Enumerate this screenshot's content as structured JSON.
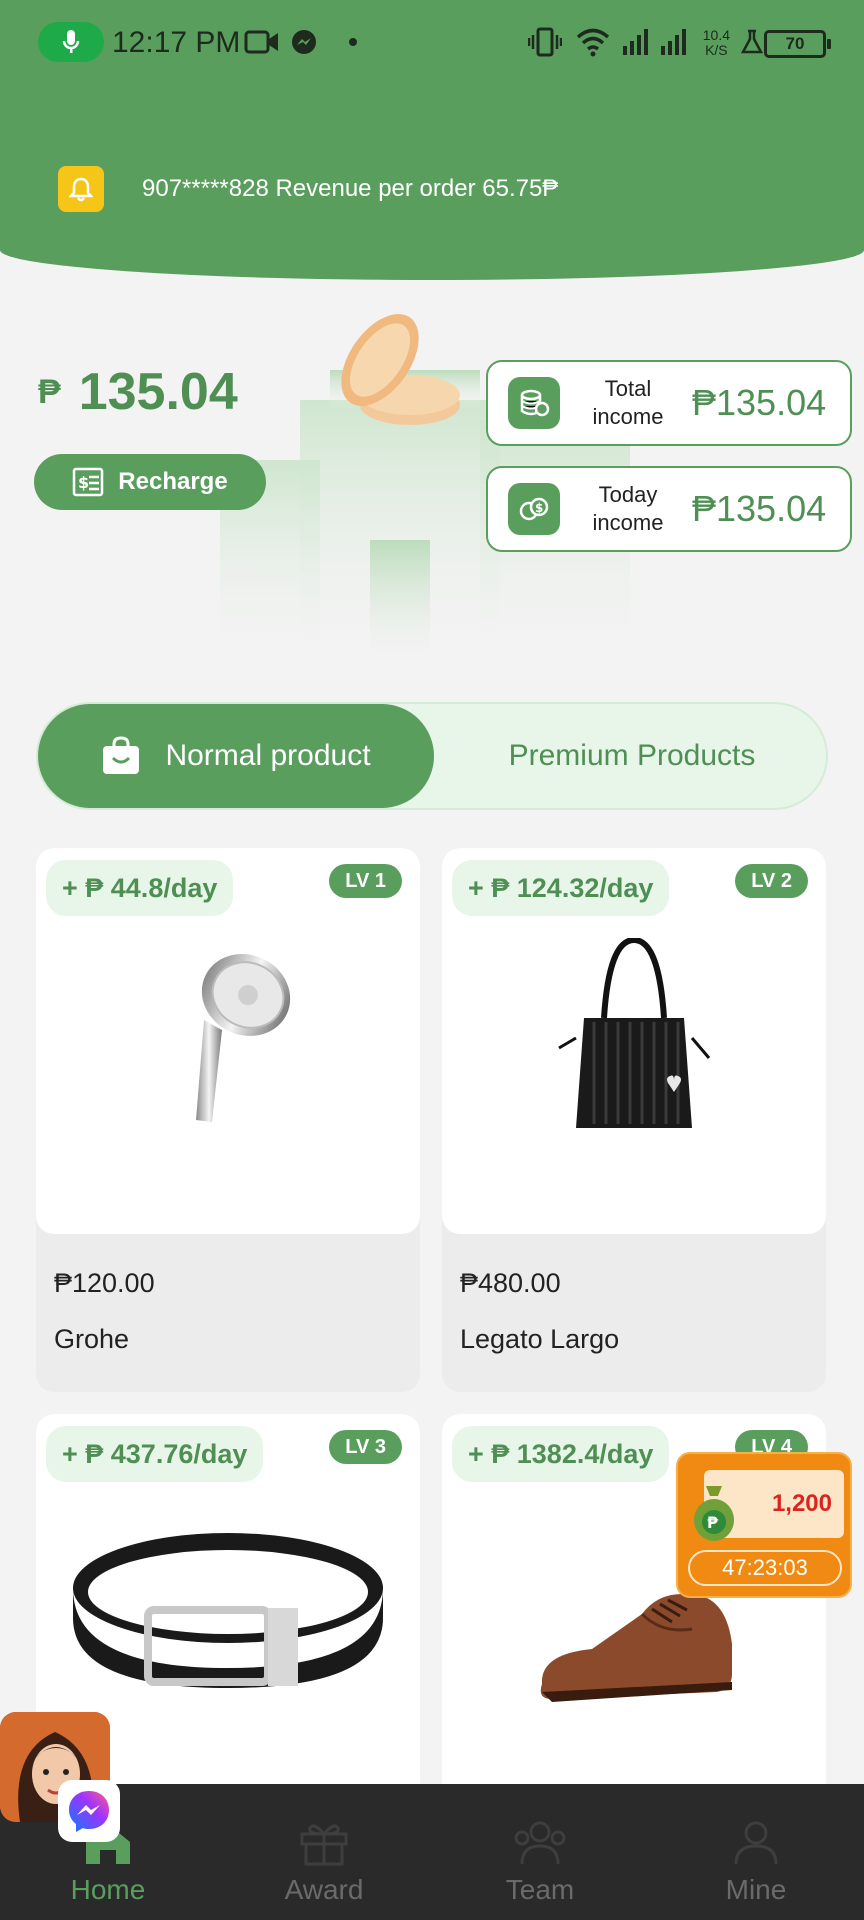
{
  "status_bar": {
    "time": "12:17 PM",
    "net_speed_top": "10.4",
    "net_speed_bottom": "K/S",
    "battery": "70"
  },
  "notice": {
    "text": "907*****828 Revenue per order 65.75₱"
  },
  "balance": {
    "currency": "₱",
    "amount": "135.04",
    "recharge_label": "Recharge"
  },
  "income": {
    "total_label_1": "Total",
    "total_label_2": "income",
    "total_value": "₱135.04",
    "today_label_1": "Today",
    "today_label_2": "income",
    "today_value": "₱135.04"
  },
  "tabs": {
    "normal": "Normal product",
    "premium": "Premium Products",
    "active": "normal"
  },
  "products": [
    {
      "earn": "+ ₱ 44.8/day",
      "level": "LV 1",
      "price": "₱120.00",
      "name": "Grohe",
      "icon": "shower-head-icon"
    },
    {
      "earn": "+ ₱ 124.32/day",
      "level": "LV 2",
      "price": "₱480.00",
      "name": "Legato Largo",
      "icon": "handbag-icon"
    },
    {
      "earn": "+ ₱ 437.76/day",
      "level": "LV 3",
      "icon": "belt-icon"
    },
    {
      "earn": "+ ₱ 1382.4/day",
      "level": "LV 4",
      "icon": "shoe-icon"
    }
  ],
  "reward": {
    "amount": "1,200",
    "timer": "47:23:03"
  },
  "nav": {
    "items": [
      {
        "label": "Home",
        "icon": "home-icon"
      },
      {
        "label": "Award",
        "icon": "gift-icon"
      },
      {
        "label": "Team",
        "icon": "team-icon"
      },
      {
        "label": "Mine",
        "icon": "user-icon"
      }
    ],
    "active": "Home"
  },
  "colors": {
    "brand_green": "#5a9e5e",
    "reward_orange": "#f08a12",
    "nav_bg": "#2a2a2a"
  }
}
